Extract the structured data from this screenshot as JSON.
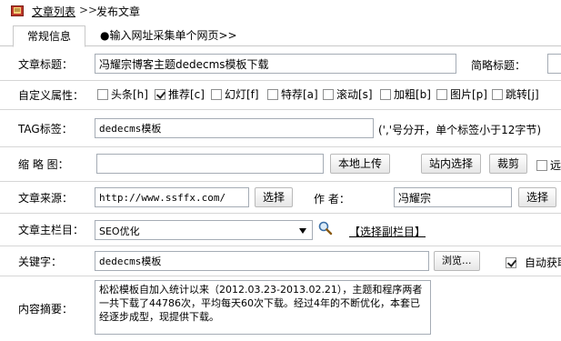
{
  "breadcrumb": {
    "list_link": "文章列表",
    "separator": ">>",
    "current": "发布文章"
  },
  "tabs": {
    "basic": "常规信息",
    "collect": "●输入网址采集单个网页>>"
  },
  "title_row": {
    "label": "文章标题：",
    "value": "冯耀宗博客主题dedecms模板下载",
    "short_label": "简略标题："
  },
  "attr_row": {
    "label": "自定义属性：",
    "items": [
      {
        "label": "头条[h]",
        "checked": false
      },
      {
        "label": "推荐[c]",
        "checked": true
      },
      {
        "label": "幻灯[f]",
        "checked": false
      },
      {
        "label": "特荐[a]",
        "checked": false
      },
      {
        "label": "滚动[s]",
        "checked": false
      },
      {
        "label": "加粗[b]",
        "checked": false
      },
      {
        "label": "图片[p]",
        "checked": false
      },
      {
        "label": "跳转[j]",
        "checked": false
      }
    ]
  },
  "tag_row": {
    "label": "TAG标签：",
    "value": "dedecms模板",
    "hint": "(','号分开，单个标签小于12字节)"
  },
  "thumb_row": {
    "label": "缩 略 图：",
    "value": "",
    "upload": "本地上传",
    "site_select": "站内选择",
    "crop": "裁剪",
    "remote": "远"
  },
  "source_row": {
    "label": "文章来源：",
    "value": "http://www.ssffx.com/",
    "select": "选择",
    "author_label": "作 者：",
    "author_value": "冯耀宗",
    "author_select": "选择"
  },
  "column_row": {
    "label": "文章主栏目：",
    "selected": "SEO优化",
    "sub_link": "【选择副栏目】"
  },
  "keyword_row": {
    "label": "关键字：",
    "value": "dedecms模板",
    "browse": "浏览...",
    "auto_fetch": "自动获取"
  },
  "summary_row": {
    "label": "内容摘要：",
    "value": "松松模板自加入统计以来（2012.03.23-2013.02.21），主题和程序两者一共下载了44786次，平均每天60次下载。经过4年的不断优化，本套已经逐步成型，现提供下载。"
  },
  "colors": {
    "border": "#d6d6d6",
    "input_border": "#a5acb5",
    "tab_border": "#c9c9c9"
  }
}
